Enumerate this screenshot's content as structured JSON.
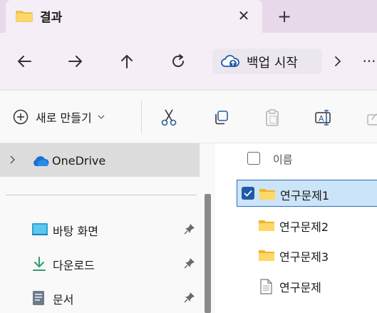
{
  "tab": {
    "title": "결과",
    "close_glyph": "✕",
    "new_tab_glyph": "+"
  },
  "address": {
    "text": "백업 시작",
    "more_glyph": "···"
  },
  "toolbar": {
    "new_label": "새로 만들기"
  },
  "sidebar": {
    "onedrive_label": "OneDrive",
    "items": [
      {
        "label": "바탕 화면",
        "icon": "desktop-icon"
      },
      {
        "label": "다운로드",
        "icon": "download-icon"
      },
      {
        "label": "문서",
        "icon": "document-icon"
      }
    ]
  },
  "content": {
    "header_name": "이름",
    "files": [
      {
        "label": "연구문제1",
        "type": "folder",
        "selected": true
      },
      {
        "label": "연구문제2",
        "type": "folder",
        "selected": false
      },
      {
        "label": "연구문제3",
        "type": "folder",
        "selected": false
      },
      {
        "label": "연구문제",
        "type": "file",
        "selected": false
      }
    ]
  },
  "colors": {
    "accent": "#1e5aa8",
    "selection": "#cce4f7",
    "folder": "#f7c948",
    "tabbar": "#e8d9ea"
  }
}
